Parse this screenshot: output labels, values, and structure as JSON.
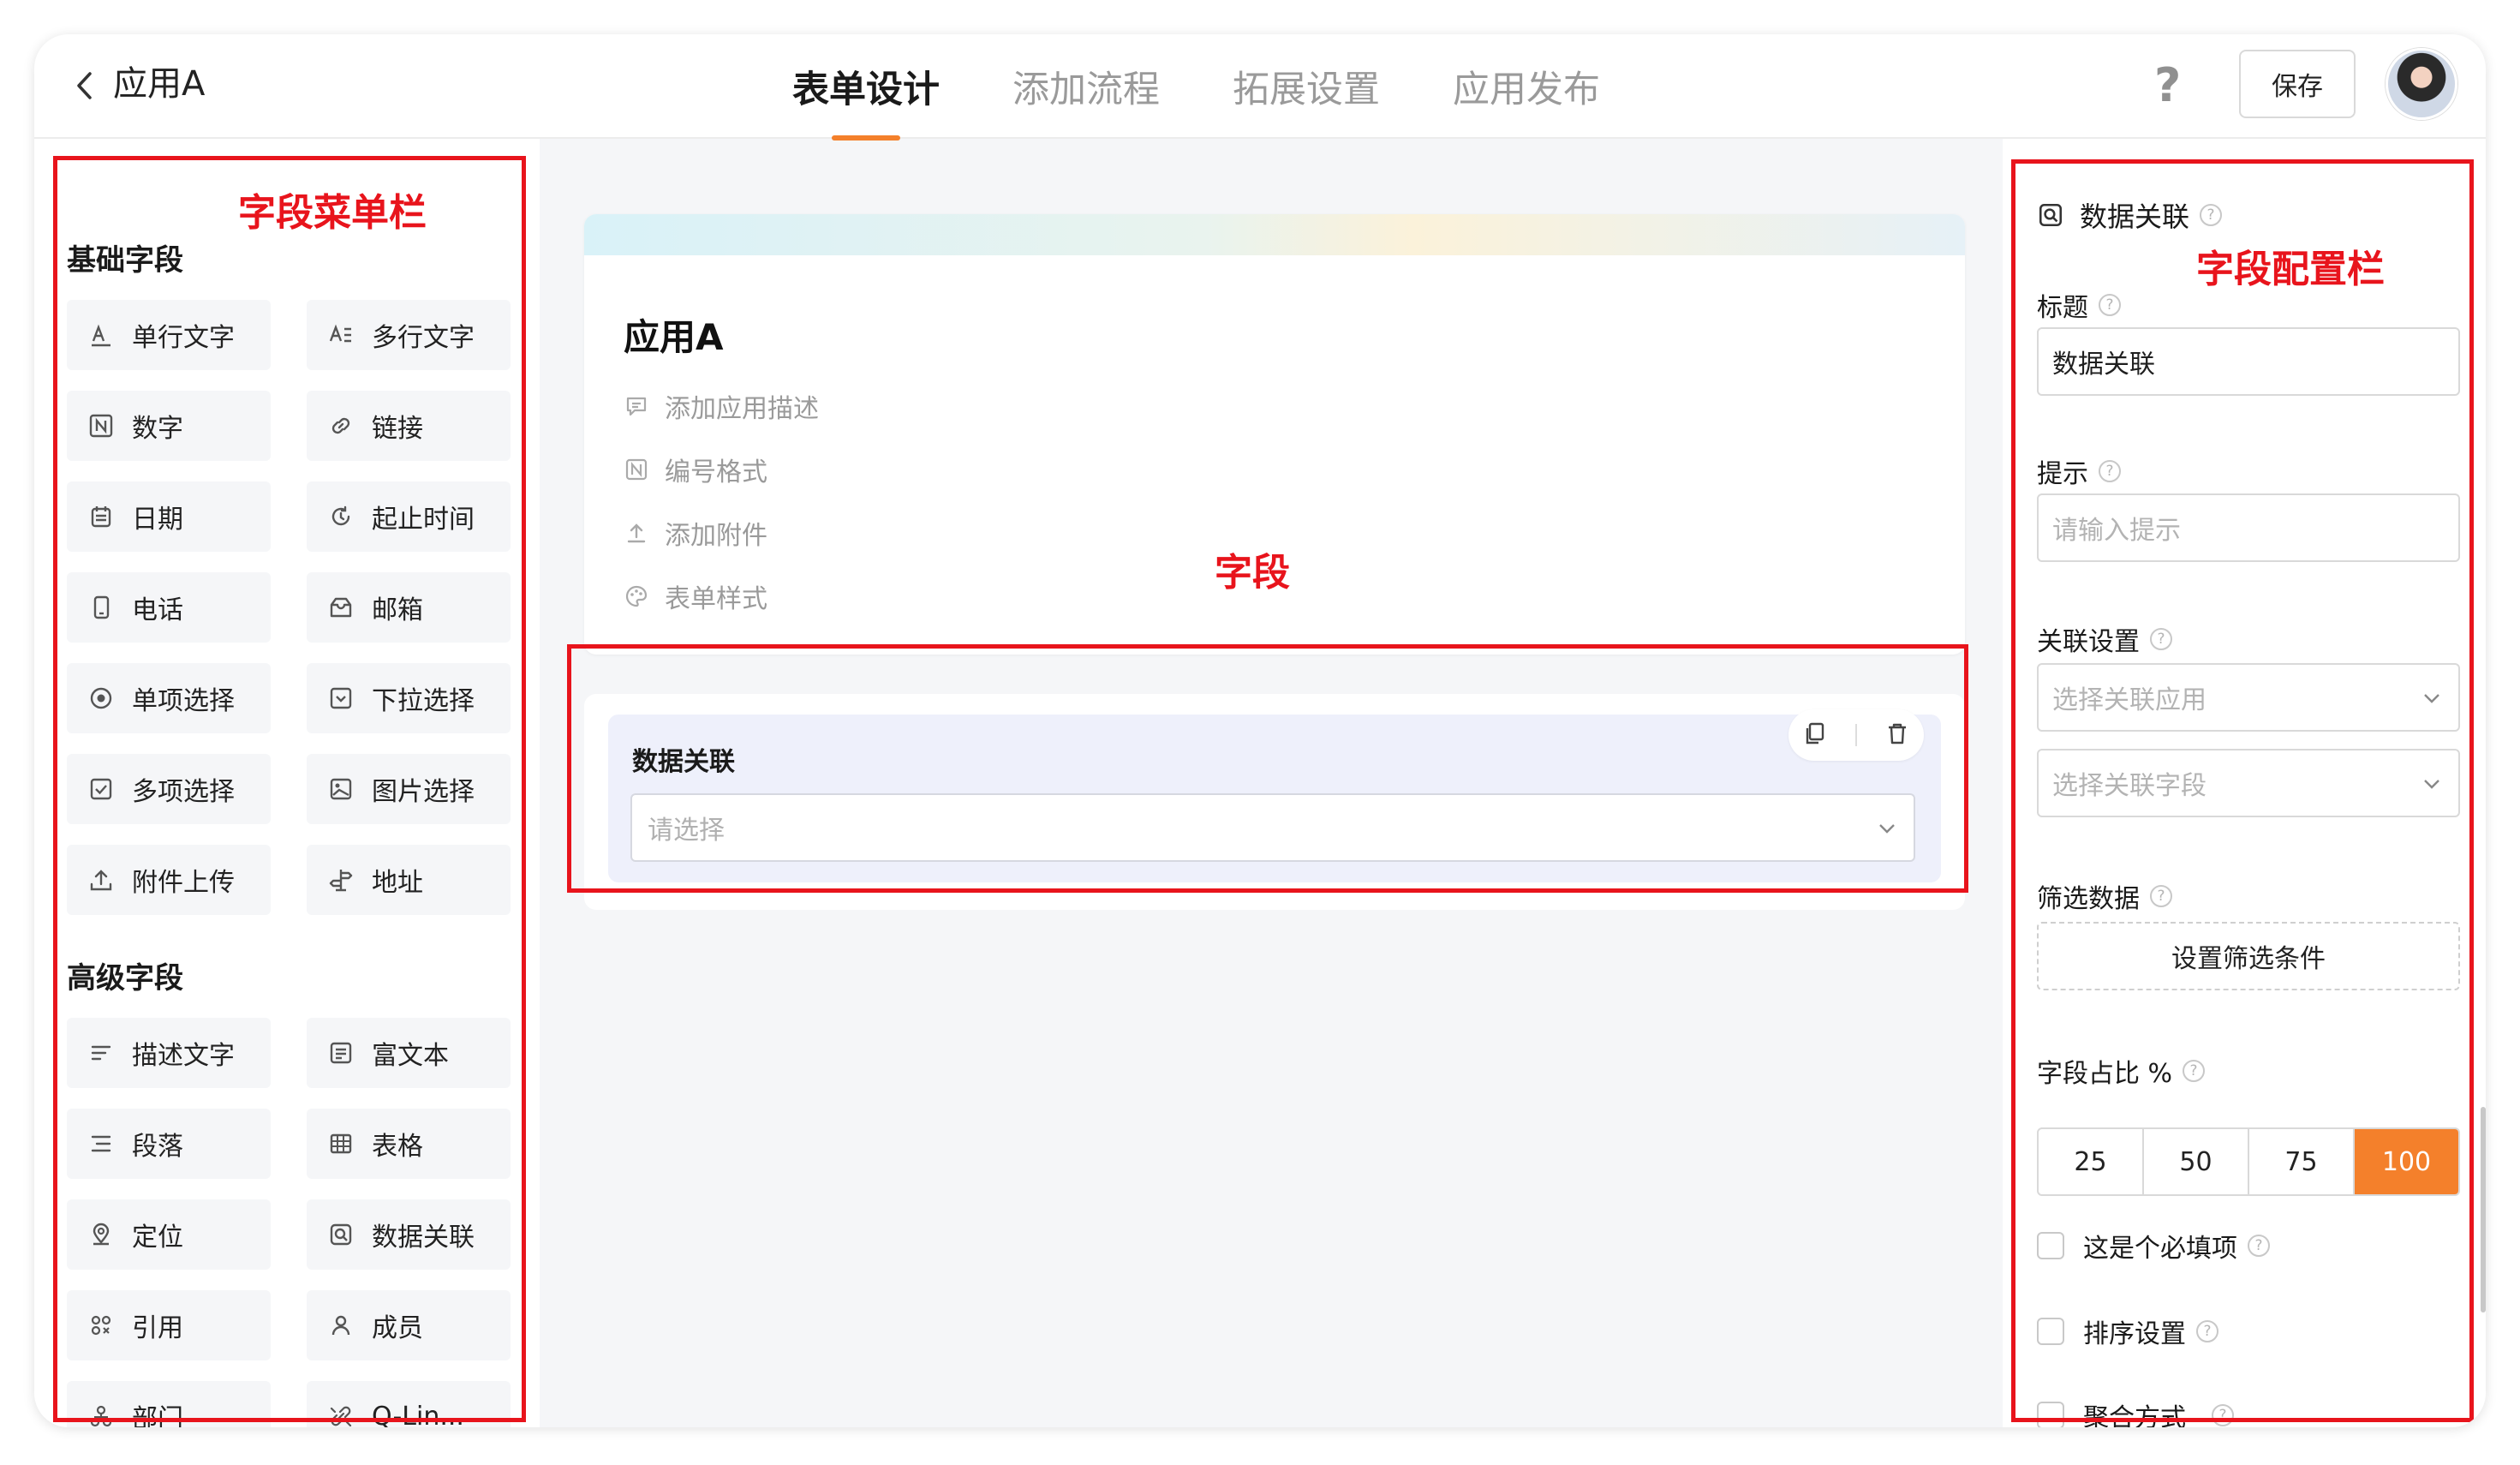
{
  "header": {
    "app_title": "应用A",
    "tabs": [
      "表单设计",
      "添加流程",
      "拓展设置",
      "应用发布"
    ],
    "help": "?",
    "save_label": "保存"
  },
  "left_panel": {
    "basic_title": "基础字段",
    "basic_items": [
      {
        "label": "单行文字",
        "icon": "single-text-icon"
      },
      {
        "label": "多行文字",
        "icon": "multi-text-icon"
      },
      {
        "label": "数字",
        "icon": "number-icon"
      },
      {
        "label": "链接",
        "icon": "link-icon"
      },
      {
        "label": "日期",
        "icon": "calendar-icon"
      },
      {
        "label": "起止时间",
        "icon": "time-range-icon"
      },
      {
        "label": "电话",
        "icon": "phone-icon"
      },
      {
        "label": "邮箱",
        "icon": "mail-icon"
      },
      {
        "label": "单项选择",
        "icon": "radio-icon"
      },
      {
        "label": "下拉选择",
        "icon": "dropdown-icon"
      },
      {
        "label": "多项选择",
        "icon": "checkbox-icon"
      },
      {
        "label": "图片选择",
        "icon": "image-icon"
      },
      {
        "label": "附件上传",
        "icon": "upload-icon"
      },
      {
        "label": "地址",
        "icon": "signpost-icon"
      }
    ],
    "advanced_title": "高级字段",
    "advanced_items": [
      {
        "label": "描述文字",
        "icon": "description-icon"
      },
      {
        "label": "富文本",
        "icon": "rich-text-icon"
      },
      {
        "label": "段落",
        "icon": "paragraph-icon"
      },
      {
        "label": "表格",
        "icon": "table-icon"
      },
      {
        "label": "定位",
        "icon": "location-icon"
      },
      {
        "label": "数据关联",
        "icon": "data-link-icon"
      },
      {
        "label": "引用",
        "icon": "reference-icon"
      },
      {
        "label": "成员",
        "icon": "member-icon"
      },
      {
        "label": "部门",
        "icon": "department-icon"
      },
      {
        "label": "Q-Lin...",
        "icon": "q-link-icon"
      }
    ]
  },
  "form": {
    "name": "应用A",
    "options": [
      {
        "label": "添加应用描述",
        "icon": "comment-icon"
      },
      {
        "label": "编号格式",
        "icon": "number-format-icon"
      },
      {
        "label": "添加附件",
        "icon": "attach-icon"
      },
      {
        "label": "表单样式",
        "icon": "palette-icon"
      }
    ],
    "field": {
      "label": "数据关联",
      "placeholder": "请选择"
    }
  },
  "config": {
    "header": "数据关联",
    "title_label": "标题",
    "title_value": "数据关联",
    "hint_label": "提示",
    "hint_placeholder": "请输入提示",
    "link_label": "关联设置",
    "link_app_placeholder": "选择关联应用",
    "link_field_placeholder": "选择关联字段",
    "filter_label": "筛选数据",
    "filter_button": "设置筛选条件",
    "ratio_label": "字段占比 %",
    "ratio_options": [
      "25",
      "50",
      "75",
      "100"
    ],
    "ratio_selected": "100",
    "required_label": "这是个必填项",
    "sort_label": "排序设置",
    "aggregate_label": "聚合方式"
  },
  "annotations": {
    "menu": "字段菜单栏",
    "field": "字段",
    "config": "字段配置栏"
  },
  "colors": {
    "accent": "#f4802b",
    "annotation_red": "#e8141c",
    "field_bg": "#eef0fb"
  }
}
